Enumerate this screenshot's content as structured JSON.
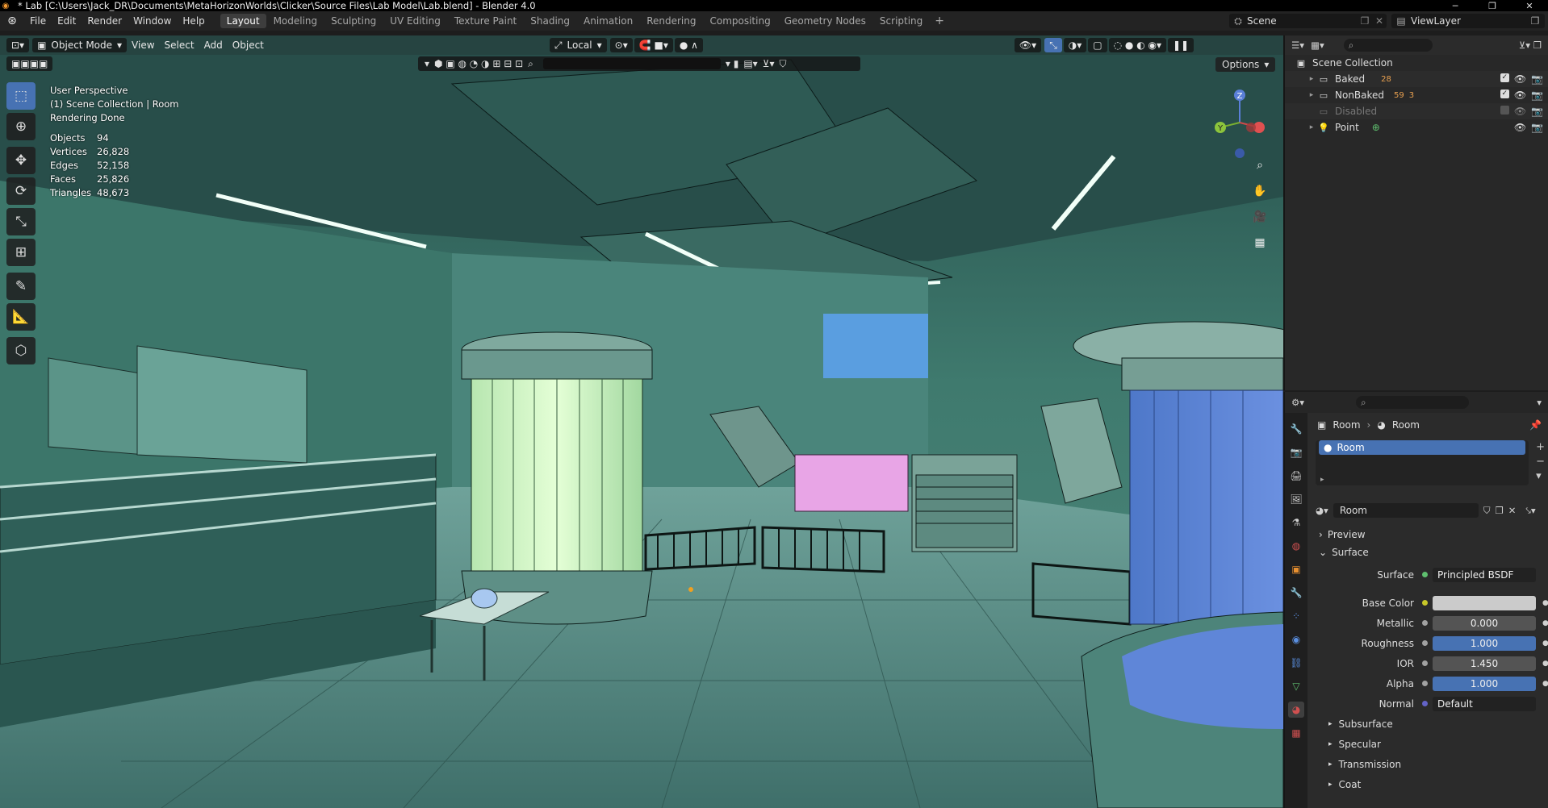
{
  "window": {
    "title": "* Lab [C:\\Users\\Jack_DR\\Documents\\MetaHorizonWorlds\\Clicker\\Source Files\\Lab Model\\Lab.blend] - Blender 4.0",
    "minimize": "─",
    "maximize": "❐",
    "close": "✕"
  },
  "menu": [
    "File",
    "Edit",
    "Render",
    "Window",
    "Help"
  ],
  "workspaces": [
    "Layout",
    "Modeling",
    "Sculpting",
    "UV Editing",
    "Texture Paint",
    "Shading",
    "Animation",
    "Rendering",
    "Compositing",
    "Geometry Nodes",
    "Scripting"
  ],
  "active_workspace": "Layout",
  "scene": {
    "name": "Scene",
    "view_layer": "ViewLayer"
  },
  "viewport": {
    "mode": "Object Mode",
    "menus": [
      "View",
      "Select",
      "Add",
      "Object"
    ],
    "transform_orientation": "Local",
    "options_label": "Options",
    "overlay_lines": [
      "User Perspective",
      "(1) Scene Collection | Room",
      "Rendering Done"
    ],
    "stats": [
      {
        "label": "Objects",
        "value": "94"
      },
      {
        "label": "Vertices",
        "value": "26,828"
      },
      {
        "label": "Edges",
        "value": "52,158"
      },
      {
        "label": "Faces",
        "value": "25,826"
      },
      {
        "label": "Triangles",
        "value": "48,673"
      }
    ],
    "gizmo_axes": [
      "Z",
      "Y",
      "X"
    ]
  },
  "outliner": {
    "root": "Scene Collection",
    "items": [
      {
        "label": "Baked",
        "badge": "28",
        "checked": true
      },
      {
        "label": "NonBaked",
        "badge": "59",
        "badge2": "3",
        "checked": true
      },
      {
        "label": "Disabled",
        "checked": false
      },
      {
        "label": "Point"
      }
    ]
  },
  "properties": {
    "breadcrumb": [
      "Room",
      "Room"
    ],
    "material_slot": "Room",
    "material_name": "Room",
    "panels": {
      "preview": "Preview",
      "surface": "Surface"
    },
    "surface_shader": {
      "label": "Surface",
      "value": "Principled BSDF"
    },
    "fields": [
      {
        "label": "Base Color",
        "value": "",
        "style": "light",
        "dot": "#c7c729"
      },
      {
        "label": "Metallic",
        "value": "0.000",
        "style": "grey",
        "dot": "#a1a1a1"
      },
      {
        "label": "Roughness",
        "value": "1.000",
        "style": "blue",
        "dot": "#a1a1a1"
      },
      {
        "label": "IOR",
        "value": "1.450",
        "style": "grey",
        "dot": "#a1a1a1"
      },
      {
        "label": "Alpha",
        "value": "1.000",
        "style": "blue",
        "dot": "#a1a1a1"
      },
      {
        "label": "Normal",
        "value": "Default",
        "style": "dark",
        "dot": "#6363c7"
      }
    ],
    "subpanels": [
      "Subsurface",
      "Specular",
      "Transmission",
      "Coat"
    ]
  },
  "colors": {
    "accent": "#4772b3",
    "header": "#232323",
    "panel": "#2b2b2b"
  }
}
